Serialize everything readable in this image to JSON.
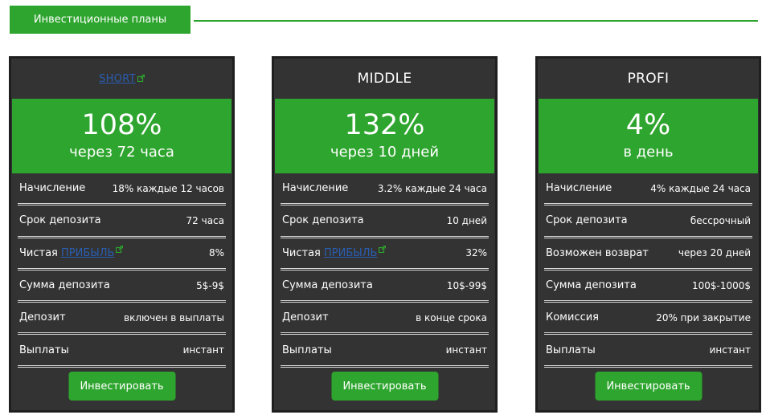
{
  "header": {
    "tab_label": "Инвестиционные планы"
  },
  "colors": {
    "accent": "#2ea52e",
    "card_bg": "#333333",
    "link": "#2a5db0"
  },
  "plans": [
    {
      "title": "SHORT",
      "title_is_link": true,
      "percent": "108%",
      "period": "через 72 часа",
      "rows": [
        {
          "label": "Начисление",
          "value": "18% каждые 12 часов"
        },
        {
          "label_prefix": "Чистая ",
          "label_link": "ПРИБЫЛЬ",
          "value": "8%"
        },
        {
          "label": "Срок депозита",
          "value": "72 часа"
        },
        {
          "label": "Сумма депозита",
          "value": "5$-9$"
        },
        {
          "label": "Депозит",
          "value": "включен в выплаты"
        },
        {
          "label": "Выплаты",
          "value": "инстант"
        }
      ],
      "button": "Инвестировать"
    },
    {
      "title": "MIDDLE",
      "percent": "132%",
      "period": "через 10 дней",
      "rows": [
        {
          "label": "Начисление",
          "value": "3.2% каждые 24 часа"
        },
        {
          "label": "Срок депозита",
          "value": "10 дней"
        },
        {
          "label_prefix": "Чистая ",
          "label_link": "ПРИБЫЛЬ",
          "value": "32%"
        },
        {
          "label": "Сумма депозита",
          "value": "10$-99$"
        },
        {
          "label": "Депозит",
          "value": "в конце срока"
        },
        {
          "label": "Выплаты",
          "value": "инстант"
        }
      ],
      "button": "Инвестировать"
    },
    {
      "title": "PROFI",
      "percent": "4%",
      "period": "в день",
      "rows": [
        {
          "label": "Начисление",
          "value": "4% каждые 24 часа"
        },
        {
          "label": "Срок депозита",
          "value": "бессрочный"
        },
        {
          "label": "Возможен возврат",
          "value": "через 20 дней"
        },
        {
          "label": "Сумма депозита",
          "value": "100$-1000$"
        },
        {
          "label": "Комиссия",
          "value": "20% при закрытие"
        },
        {
          "label": "Выплаты",
          "value": "инстант"
        }
      ],
      "button": "Инвестировать"
    }
  ]
}
